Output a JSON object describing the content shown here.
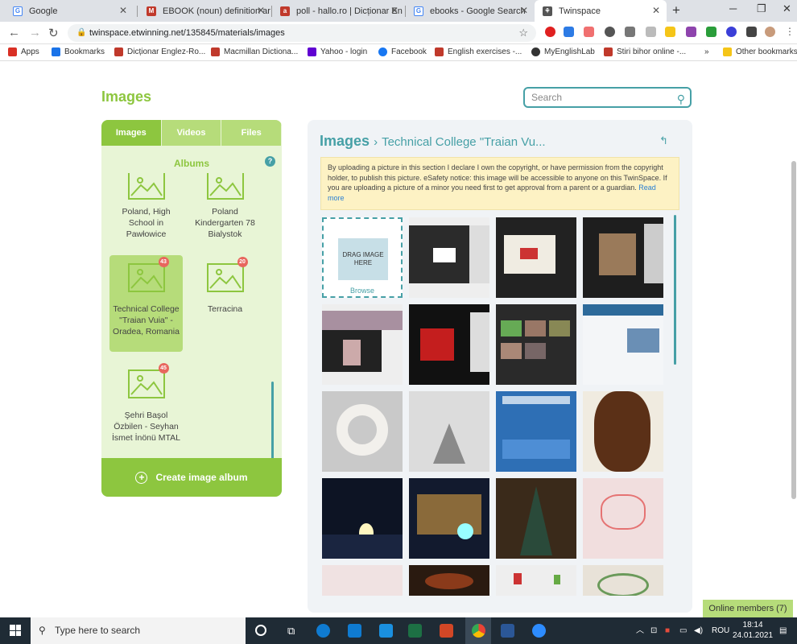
{
  "browser": {
    "tabs": [
      {
        "title": "Google",
        "icon_color": "#4285f4"
      },
      {
        "title": "EBOOK (noun) definition ar",
        "icon_color": "#c0392b"
      },
      {
        "title": "poll - hallo.ro | Dicționar En",
        "icon_color": "#c0392b"
      },
      {
        "title": "ebooks - Google Search",
        "icon_color": "#4285f4"
      },
      {
        "title": "Twinspace",
        "icon_color": "#333333"
      }
    ],
    "url": "twinspace.etwinning.net/135845/materials/images",
    "bookmarks": [
      {
        "label": "Apps",
        "color": "#d93025"
      },
      {
        "label": "Bookmarks",
        "color": "#1a73e8"
      },
      {
        "label": "Dicționar Englez-Ro...",
        "color": "#c0392b"
      },
      {
        "label": "Macmillan Dictiona...",
        "color": "#c0392b"
      },
      {
        "label": "Yahoo - login",
        "color": "#6001d2"
      },
      {
        "label": "Facebook",
        "color": "#1877f2"
      },
      {
        "label": "English exercises -...",
        "color": "#c0392b"
      },
      {
        "label": "MyEnglishLab",
        "color": "#333333"
      },
      {
        "label": "Stiri bihor online -...",
        "color": "#c0392b"
      }
    ],
    "overflow": "»",
    "other_bookmarks": "Other bookmarks"
  },
  "page": {
    "title": "Images",
    "search_placeholder": "Search",
    "tabs": [
      "Images",
      "Videos",
      "Files"
    ],
    "albums_heading": "Albums",
    "help": "?",
    "albums": [
      {
        "name": "Poland, High School in Pawłowice",
        "badge": ""
      },
      {
        "name": "Poland Kindergarten 78 Bialystok",
        "badge": ""
      },
      {
        "name": "Technical College \"Traian Vuia\" - Oradea, Romania",
        "badge": "43"
      },
      {
        "name": "Terracina",
        "badge": "20"
      },
      {
        "name": "Şehri Başol Özbilen - Seyhan İsmet İnönü MTAL",
        "badge": "45"
      }
    ],
    "create_album": "Create image album",
    "breadcrumb_root": "Images",
    "breadcrumb_sep": "›",
    "breadcrumb_current": "Technical College \"Traian Vu...",
    "notice": "By uploading a picture in this section I declare I own the copyright, or have permission from the copyright holder, to publish this picture. eSafety notice: this image will be accessible to anyone on this TwinSpace. If you are uploading a picture of a minor you need first to get approval from a parent or a guardian.",
    "read_more": "Read more",
    "drop_text": "DRAG IMAGE HERE",
    "browse": "Browse",
    "online_members": "Online members (7)"
  },
  "taskbar": {
    "search_placeholder": "Type here to search",
    "lang": "ROU",
    "time": "18:14",
    "date": "24.01.2021"
  }
}
